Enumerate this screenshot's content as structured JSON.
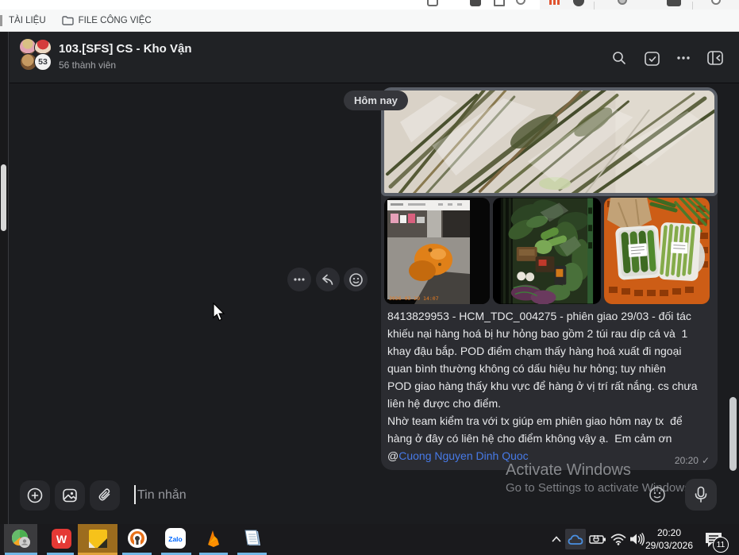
{
  "browser": {
    "bookmarks": [
      {
        "label": "TÀI LIỆU"
      },
      {
        "label": "FILE CÔNG VIỆC"
      }
    ]
  },
  "header": {
    "title": "103.[SFS] CS - Kho Vận",
    "subtitle": "56 thành viên",
    "avatar_badge": "53"
  },
  "conversation": {
    "date_badge": "Hôm nay",
    "message": {
      "lines": [
        "8413829953 - HCM_TDC_004275 - phiên giao 29/03 - đối tác",
        "khiếu nại hàng hoá bị hư hỏng bao gồm 2 túi rau díp cá và  1",
        "khay đậu bắp. POD điểm chạm thấy hàng hoá xuất đi ngoại",
        "quan bình thường không có dấu hiệu hư hỏng; tuy nhiên",
        "POD giao hàng thấy khu vực để hàng ở vị trí rất nắng. cs chưa",
        "liên hệ được cho điểm.",
        "Nhờ team kiểm tra với tx giúp em phiên giao hôm nay tx  để",
        "hàng ở đây có liên hệ cho điểm không vậy ạ.  Em cảm ơn"
      ],
      "mention_at": "@",
      "mention_name": "Cuong Nguyen Dinh Quoc",
      "time": "20:20",
      "read_check": "✓",
      "photo1_watermark": "2026-03-29 14:07"
    }
  },
  "composer": {
    "placeholder": "Tin nhắn"
  },
  "watermark": {
    "line1": "Activate Windows",
    "line2": "Go to Settings to activate Windows."
  },
  "taskbar": {
    "time": "20:20",
    "date": "29/03/2026",
    "notification_count": "11"
  },
  "colors": {
    "mention_blue": "#477ae8",
    "taskbar_underline": "#71b7e6",
    "zalo_blue": "#0068ff",
    "wps_red": "#e53935",
    "active_app_highlight": "#9c6c1e"
  }
}
